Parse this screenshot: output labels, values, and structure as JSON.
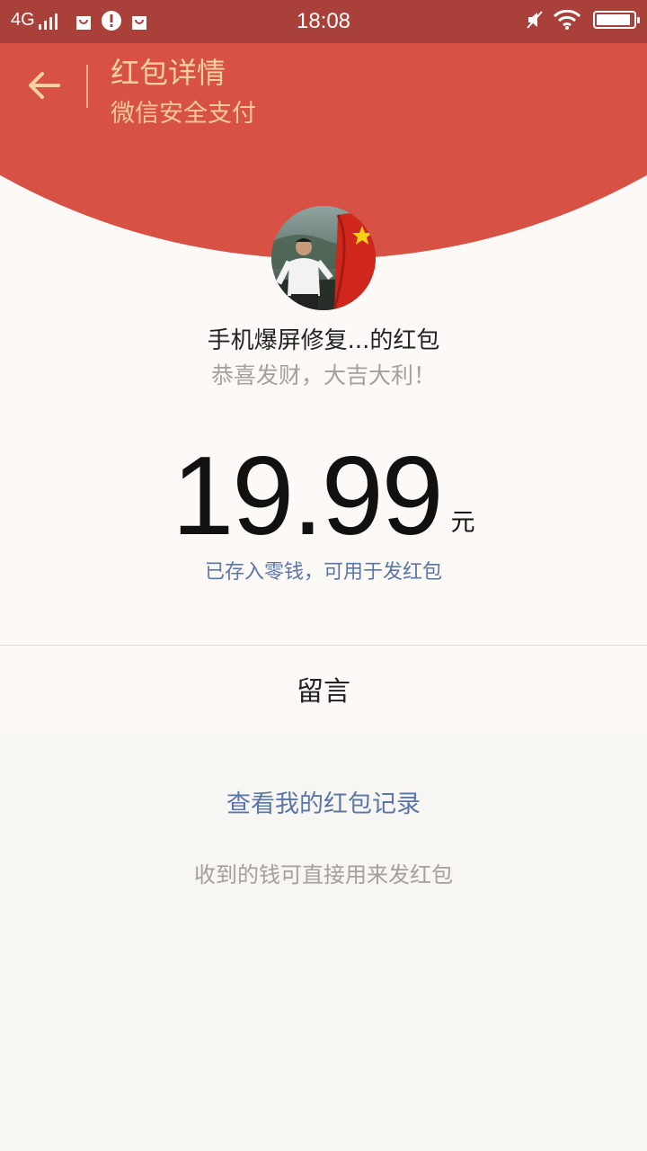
{
  "status_bar": {
    "network": "4G",
    "time": "18:08",
    "battery_level": 0.92
  },
  "header": {
    "title": "红包详情",
    "subtitle": "微信安全支付"
  },
  "packet": {
    "sender": "手机爆屏修复...的红包",
    "greeting": "恭喜发财，大吉大利！",
    "amount": "19.99",
    "currency": "元",
    "stored_note": "已存入零钱，可用于发红包"
  },
  "message_label": "留言",
  "records_link": "查看我的红包记录",
  "hint": "收到的钱可直接用来发红包",
  "colors": {
    "status_bar": "#a9403a",
    "header": "#d75244",
    "header_text": "#f7d2a0",
    "link": "#5a76a8"
  }
}
